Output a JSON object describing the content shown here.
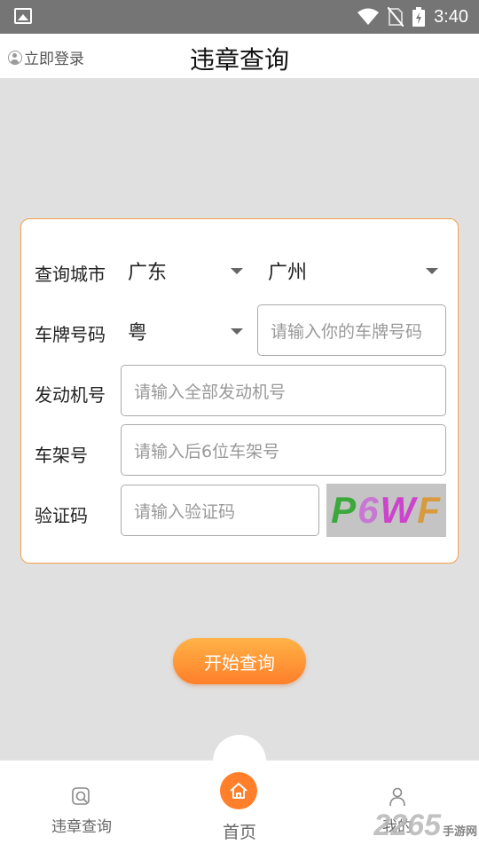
{
  "status_bar": {
    "time": "3:40"
  },
  "header": {
    "login_label": "立即登录",
    "title": "违章查询"
  },
  "form": {
    "city": {
      "label": "查询城市",
      "province": "广东",
      "city": "广州"
    },
    "plate": {
      "label": "车牌号码",
      "prefix": "粤",
      "placeholder": "请输入你的车牌号码"
    },
    "engine": {
      "label": "发动机号",
      "placeholder": "请输入全部发动机号"
    },
    "frame": {
      "label": "车架号",
      "placeholder": "请输入后6位车架号"
    },
    "captcha": {
      "label": "验证码",
      "placeholder": "请输入验证码",
      "image_text": "P6WF"
    }
  },
  "actions": {
    "start_label": "开始查询"
  },
  "tabbar": {
    "items": [
      {
        "label": "违章查询",
        "icon": "search-icon"
      },
      {
        "label": "首页",
        "icon": "home-icon"
      },
      {
        "label": "我的",
        "icon": "user-icon"
      }
    ]
  },
  "watermark": {
    "text": "2265",
    "sub": "手游网"
  },
  "colors": {
    "accent": "#ff7f2a",
    "card_border": "#f5a049",
    "status_bar": "#757575"
  }
}
